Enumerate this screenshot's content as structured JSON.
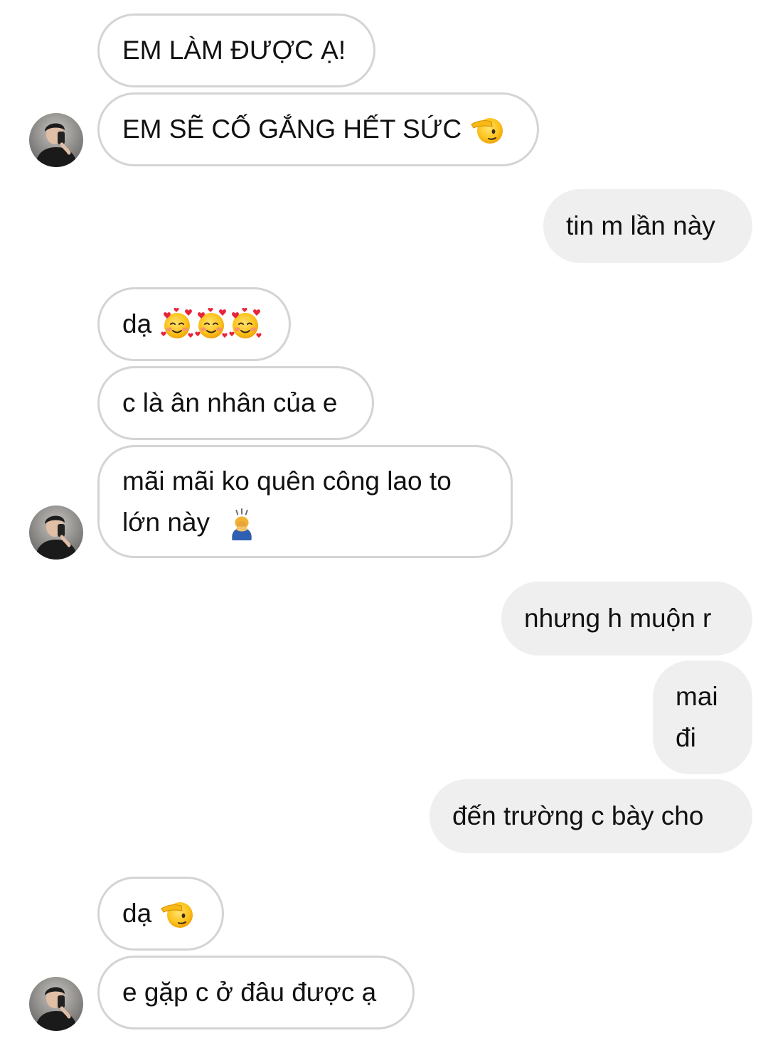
{
  "chat": {
    "messages": [
      {
        "id": "m1",
        "side": "incoming",
        "text": "EM LÀM ĐƯỢC Ạ!"
      },
      {
        "id": "m2",
        "side": "incoming",
        "text": "EM SẼ CỐ GẮNG HẾT SỨC",
        "emoji": "saluting-face-icon"
      },
      {
        "id": "m3",
        "side": "outgoing",
        "text": "tin m lần này"
      },
      {
        "id": "m4",
        "side": "incoming",
        "text": "dạ",
        "emoji": "smiling-face-with-hearts-icon x3"
      },
      {
        "id": "m5",
        "side": "incoming",
        "text": "c là ân nhân của e"
      },
      {
        "id": "m6",
        "side": "incoming",
        "line1": "mãi mãi ko quên công lao to",
        "line2": "lớn này",
        "emoji": "bowing-person-icon"
      },
      {
        "id": "m7",
        "side": "outgoing",
        "text": "nhưng h muộn r"
      },
      {
        "id": "m8",
        "side": "outgoing",
        "line1": "mai",
        "line2": "đi"
      },
      {
        "id": "m9",
        "side": "outgoing",
        "text": "đến trường c bày cho"
      },
      {
        "id": "m10",
        "side": "incoming",
        "text": "dạ",
        "emoji": "saluting-face-icon"
      },
      {
        "id": "m11",
        "side": "incoming",
        "text": "e gặp c ở đâu được ạ"
      }
    ]
  },
  "colors": {
    "incoming_border": "#d4d4d4",
    "outgoing_bg": "#efefef",
    "text": "#111111",
    "emoji_yellow": "#f9c21a",
    "heart_red": "#e8243a"
  }
}
